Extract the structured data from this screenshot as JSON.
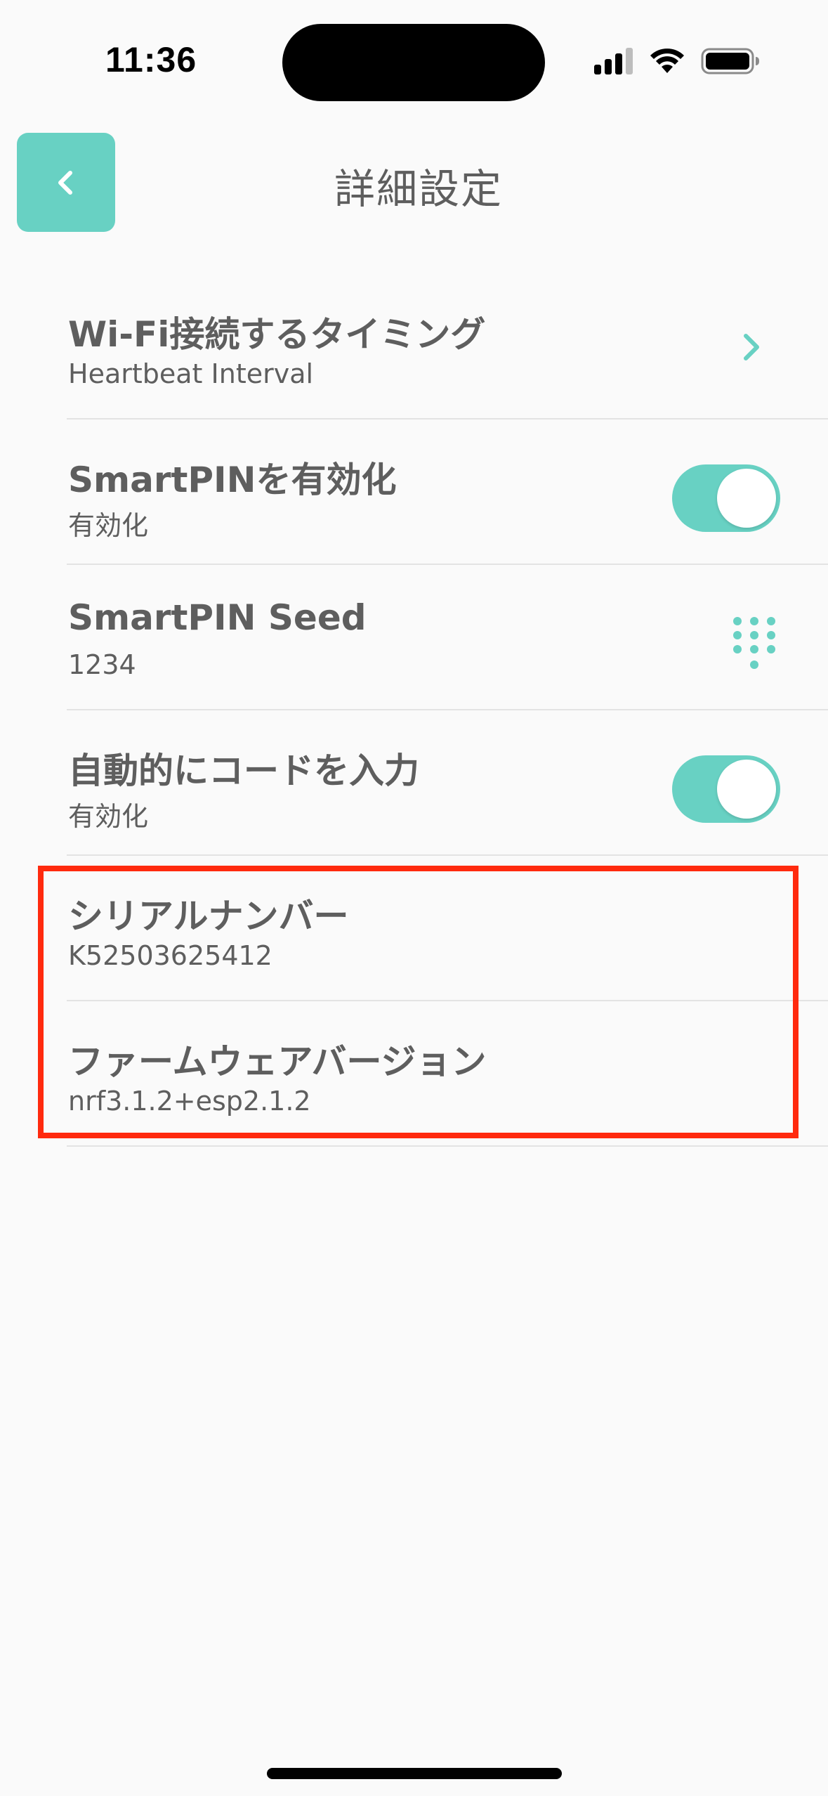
{
  "status_bar": {
    "time": "11:36"
  },
  "header": {
    "title": "詳細設定",
    "back_icon": "chevron-left-icon"
  },
  "settings": [
    {
      "title": "Wi-Fi接続するタイミング",
      "subtitle": "Heartbeat Interval",
      "control": "chevron-right-icon"
    },
    {
      "title": "SmartPINを有効化",
      "subtitle": "有効化",
      "control": "toggle",
      "enabled": true
    },
    {
      "title": "SmartPIN Seed",
      "subtitle": "1234",
      "control": "keypad-icon"
    },
    {
      "title": "自動的にコードを入力",
      "subtitle": "有効化",
      "control": "toggle",
      "enabled": true
    },
    {
      "title": "シリアルナンバー",
      "subtitle": "K52503625412"
    },
    {
      "title": "ファームウェアバージョン",
      "subtitle": "nrf3.1.2+esp2.1.2"
    }
  ],
  "colors": {
    "accent": "#68d1c3",
    "text": "#5e5e5e",
    "highlight": "#ff2a0e",
    "background": "#fafafa",
    "divider": "#e3e3e3"
  }
}
